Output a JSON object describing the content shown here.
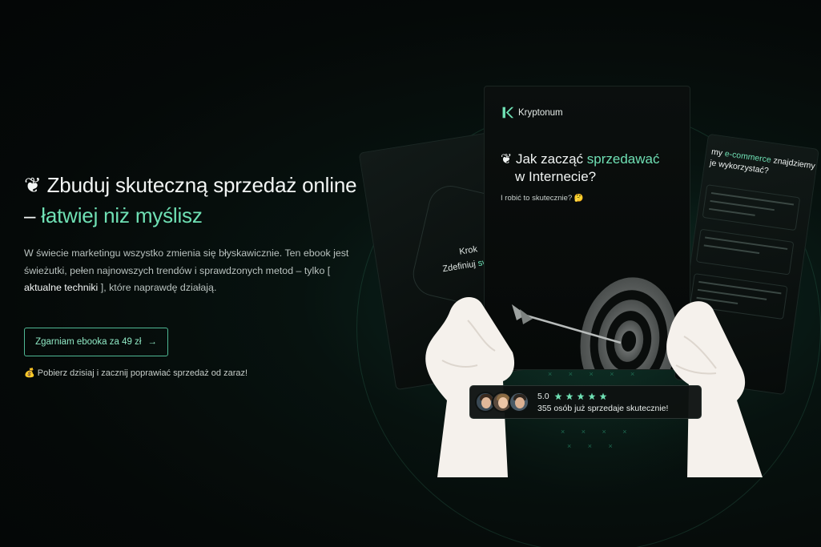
{
  "hero": {
    "emoji": "❦",
    "headline_part1": "Zbuduj skuteczną sprzedaż online – ",
    "headline_accent": "łatwiej niż myślisz",
    "lead_part1": "W świecie marketingu wszystko zmienia się błyskawicznie. Ten ebook jest świeżutki, pełen najnowszych trendów i sprawdzonych metod – tylko [ ",
    "lead_strong": "aktualne techniki",
    "lead_part2": " ], które naprawdę działają.",
    "cta_label": "Zgarniam ebooka za 49 zł",
    "cta_arrow": "→",
    "note_emoji": "💰",
    "note_text": "Pobierz dzisiaj i zacznij poprawiać sprzedaż od zaraz!"
  },
  "ebook": {
    "brand_name": "Kryptonum",
    "title_prefix": "❦ Jak zacząć ",
    "title_accent": "sprzedawać",
    "title_line2": "w Internecie?",
    "subtitle": "I robić to skutecznie? 🤔",
    "left_card_line1": "Krok",
    "left_card_line2_prefix": "Zdefiniuj ",
    "left_card_line2_accent": "sw",
    "right_card_prefix": "my ",
    "right_card_accent": "e-commerce",
    "right_card_suffix": " znajdziemy je wykorzystać?"
  },
  "social_proof": {
    "rating": "5.0",
    "stars": 5,
    "caption": "355 osób już sprzedaje skutecznie!",
    "accent_color": "#6fe0b4"
  },
  "colors": {
    "accent": "#6fe0b4",
    "background": "#050908",
    "cta_border": "#4fb894"
  }
}
